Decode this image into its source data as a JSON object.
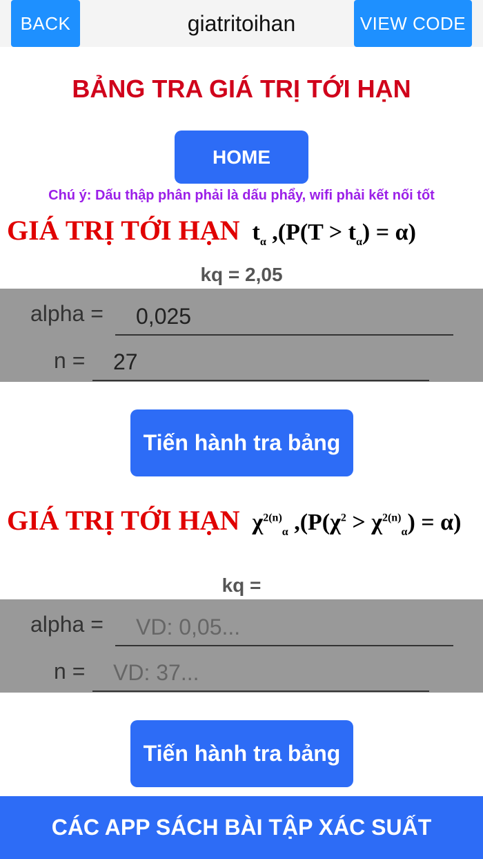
{
  "topbar": {
    "back_label": "BACK",
    "title": "giatritoihan",
    "view_code_label": "VIEW CODE"
  },
  "main_title": "BẢNG TRA GIÁ TRỊ TỚI HẠN",
  "home_label": "HOME",
  "note": "Chú ý: Dấu thập phân phải là dấu phẩy, wifi phải kết nối tốt",
  "section_t": {
    "heading": "GIÁ TRỊ TỚI HẠN",
    "formula_prefix": "t",
    "formula_sub": "α",
    "formula_mid": " ,(P(T > t",
    "formula_sub2": "α",
    "formula_end": ") = α)",
    "result": "kq = 2,05",
    "alpha_label": "alpha =",
    "alpha_value": "0,025",
    "n_label": "n =",
    "n_value": "27",
    "button_label": "Tiến hành tra bảng"
  },
  "section_chi": {
    "heading": "GIÁ TRỊ TỚI HẠN",
    "formula_prefix": "χ",
    "formula_sup": "2(n)",
    "formula_sub": "α",
    "formula_mid": " ,(P(χ",
    "formula_sup2": "2",
    "formula_mid2": " > χ",
    "formula_sup3": "2(n)",
    "formula_sub3": "α",
    "formula_end": ") = α)",
    "result": "kq =",
    "alpha_label": "alpha =",
    "alpha_placeholder": "VD: 0,05...",
    "n_label": "n =",
    "n_placeholder": "VD: 37...",
    "button_label": "Tiến hành tra bảng"
  },
  "bottom_bar_label": "CÁC APP SÁCH BÀI TẬP XÁC SUẤT",
  "colors": {
    "accent_blue": "#2d6cf6",
    "title_red": "#d0021b",
    "note_purple": "#9b1fe8",
    "panel_gray": "#999999"
  }
}
